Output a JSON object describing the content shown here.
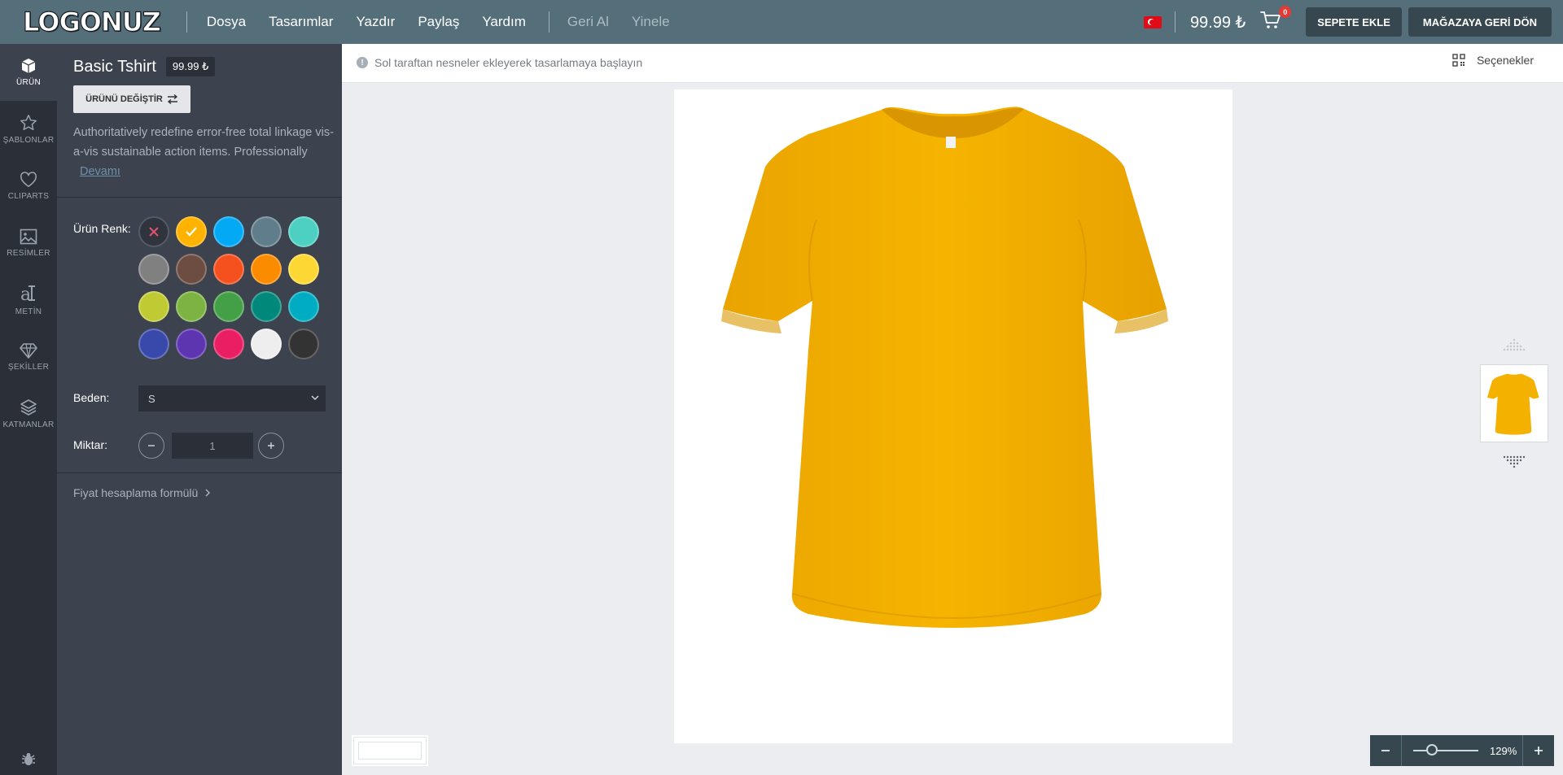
{
  "header": {
    "logo": "LOGONUZ",
    "menu": [
      "Dosya",
      "Tasarımlar",
      "Yazdır",
      "Paylaş",
      "Yardım"
    ],
    "undo": "Geri Al",
    "redo": "Yinele",
    "price": "99.99 ₺",
    "cart_count": "0",
    "add_to_cart": "SEPETE EKLE",
    "back_to_store": "MAĞAZAYA GERİ DÖN"
  },
  "rail": [
    {
      "label": "ÜRÜN",
      "icon": "cube-icon"
    },
    {
      "label": "ŞABLONLAR",
      "icon": "star-icon"
    },
    {
      "label": "CLIPARTS",
      "icon": "heart-icon"
    },
    {
      "label": "RESİMLER",
      "icon": "image-icon"
    },
    {
      "label": "METİN",
      "icon": "text-icon"
    },
    {
      "label": "ŞEKİLLER",
      "icon": "diamond-icon"
    },
    {
      "label": "KATMANLAR",
      "icon": "layers-icon"
    }
  ],
  "product": {
    "name": "Basic Tshirt",
    "price": "99.99 ₺",
    "change_button": "ÜRÜNÜ DEĞİŞTİR",
    "description": "Authoritatively redefine error-free total linkage vis-a-vis sustainable action items. Professionally",
    "more": "Devamı",
    "color_label": "Ürün Renk:",
    "colors": [
      "none",
      "#ffb300",
      "#03a9f4",
      "#607d8b",
      "#4dd0c1",
      "#808080",
      "#6d4c41",
      "#f4511e",
      "#fb8c00",
      "#fdd835",
      "#c0ca33",
      "#7cb342",
      "#43a047",
      "#00897b",
      "#00acc1",
      "#3949ab",
      "#5e35b1",
      "#e91e63",
      "#eeeeee",
      "#333333"
    ],
    "selected_color": "#ffb300",
    "size_label": "Beden:",
    "size_value": "S",
    "qty_label": "Miktar:",
    "qty_value": "1",
    "formula_link": "Fiyat hesaplama formülü"
  },
  "canvas": {
    "hint": "Sol taraftan nesneler ekleyerek tasarlamaya başlayın",
    "options": "Seçenekler",
    "shirt_color": "#f5b100"
  },
  "zoom": {
    "value": "129%",
    "level": 0.29
  }
}
